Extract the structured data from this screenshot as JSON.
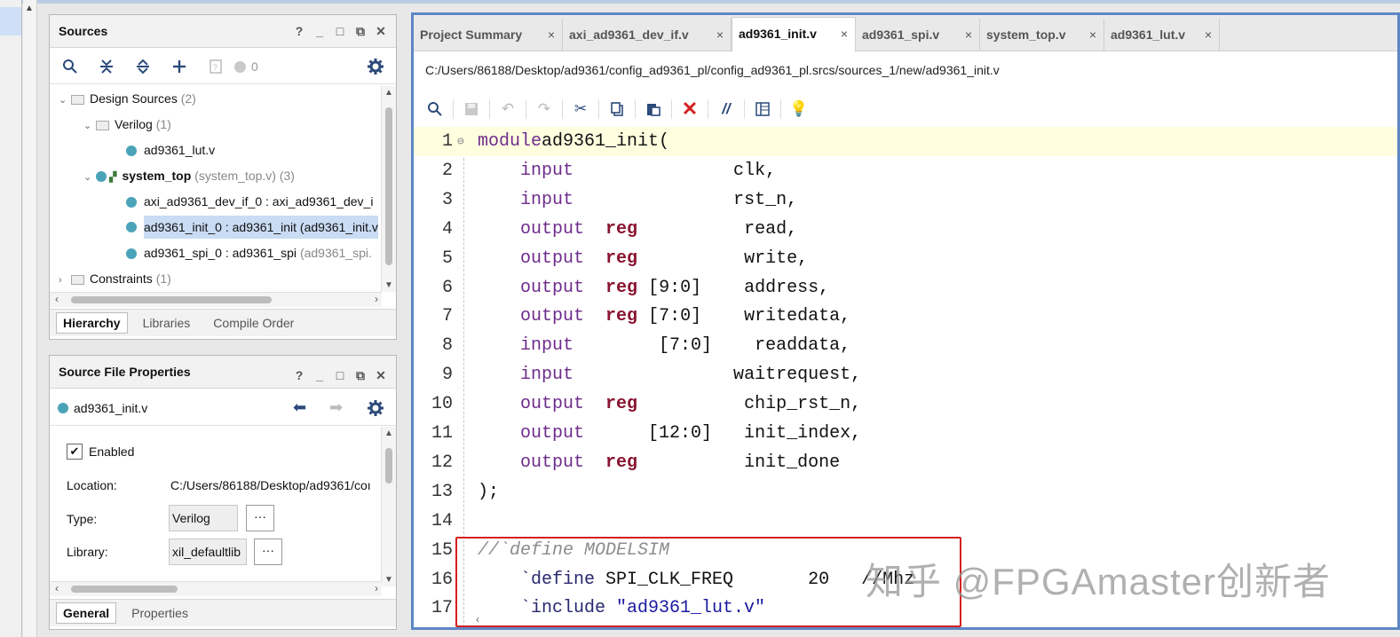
{
  "sources_panel": {
    "title": "Sources",
    "win_buttons": [
      "?",
      "_",
      "□",
      "⧉",
      "✕"
    ],
    "count": "0",
    "tree": [
      {
        "label": "Design Sources",
        "extra": "(2)"
      },
      {
        "label": "Verilog",
        "extra": "(1)"
      },
      {
        "label": "ad9361_lut.v",
        "extra": ""
      },
      {
        "label": "system_top",
        "extra": "(system_top.v) (3)"
      },
      {
        "label": "axi_ad9361_dev_if_0 : axi_ad9361_dev_i",
        "extra": ""
      },
      {
        "label": "ad9361_init_0 : ad9361_init (ad9361_init.v",
        "extra": ""
      },
      {
        "label": "ad9361_spi_0 : ad9361_spi",
        "extra": "(ad9361_spi."
      },
      {
        "label": "Constraints",
        "extra": "(1)"
      }
    ],
    "tabs": [
      "Hierarchy",
      "Libraries",
      "Compile Order"
    ]
  },
  "props_panel": {
    "title": "Source File Properties",
    "file": "ad9361_init.v",
    "enabled_label": "Enabled",
    "location_label": "Location:",
    "location_value": "C:/Users/86188/Desktop/ad9361/coı",
    "type_label": "Type:",
    "type_value": "Verilog",
    "library_label": "Library:",
    "library_value": "xil_defaultlib",
    "dots": "···",
    "tabs": [
      "General",
      "Properties"
    ]
  },
  "editor": {
    "tabs": [
      {
        "label": "Project Summary"
      },
      {
        "label": "axi_ad9361_dev_if.v"
      },
      {
        "label": "ad9361_init.v"
      },
      {
        "label": "ad9361_spi.v"
      },
      {
        "label": "system_top.v"
      },
      {
        "label": "ad9361_lut.v"
      }
    ],
    "close_glyph": "×",
    "path": "C:/Users/86188/Desktop/ad9361/config_ad9361_pl/config_ad9361_pl.srcs/sources_1/new/ad9361_init.v",
    "lines": [
      {
        "n": "1",
        "parts": [
          [
            "kw",
            "module"
          ],
          [
            "",
            "ad9361_init("
          ]
        ]
      },
      {
        "n": "2",
        "parts": [
          [
            "",
            "    "
          ],
          [
            "kw",
            "input"
          ],
          [
            "",
            "               clk,"
          ]
        ]
      },
      {
        "n": "3",
        "parts": [
          [
            "",
            "    "
          ],
          [
            "kw",
            "input"
          ],
          [
            "",
            "               rst_n,"
          ]
        ]
      },
      {
        "n": "4",
        "parts": [
          [
            "",
            "    "
          ],
          [
            "kw",
            "output"
          ],
          [
            "",
            "  "
          ],
          [
            "rg",
            "reg"
          ],
          [
            "",
            "          read,"
          ]
        ]
      },
      {
        "n": "5",
        "parts": [
          [
            "",
            "    "
          ],
          [
            "kw",
            "output"
          ],
          [
            "",
            "  "
          ],
          [
            "rg",
            "reg"
          ],
          [
            "",
            "          write,"
          ]
        ]
      },
      {
        "n": "6",
        "parts": [
          [
            "",
            "    "
          ],
          [
            "kw",
            "output"
          ],
          [
            "",
            "  "
          ],
          [
            "rg",
            "reg"
          ],
          [
            "",
            " [9:0]    address,"
          ]
        ]
      },
      {
        "n": "7",
        "parts": [
          [
            "",
            "    "
          ],
          [
            "kw",
            "output"
          ],
          [
            "",
            "  "
          ],
          [
            "rg",
            "reg"
          ],
          [
            "",
            " [7:0]    writedata,"
          ]
        ]
      },
      {
        "n": "8",
        "parts": [
          [
            "",
            "    "
          ],
          [
            "kw",
            "input"
          ],
          [
            "",
            "        [7:0]    readdata,"
          ]
        ]
      },
      {
        "n": "9",
        "parts": [
          [
            "",
            "    "
          ],
          [
            "kw",
            "input"
          ],
          [
            "",
            "               waitrequest,"
          ]
        ]
      },
      {
        "n": "10",
        "parts": [
          [
            "",
            "    "
          ],
          [
            "kw",
            "output"
          ],
          [
            "",
            "  "
          ],
          [
            "rg",
            "reg"
          ],
          [
            "",
            "          chip_rst_n,"
          ]
        ]
      },
      {
        "n": "11",
        "parts": [
          [
            "",
            "    "
          ],
          [
            "kw",
            "output"
          ],
          [
            "",
            "      [12:0]   init_index,"
          ]
        ]
      },
      {
        "n": "12",
        "parts": [
          [
            "",
            "    "
          ],
          [
            "kw",
            "output"
          ],
          [
            "",
            "  "
          ],
          [
            "rg",
            "reg"
          ],
          [
            "",
            "          init_done"
          ]
        ]
      },
      {
        "n": "13",
        "parts": [
          [
            "",
            ");"
          ]
        ]
      },
      {
        "n": "14",
        "parts": [
          [
            "",
            ""
          ]
        ]
      },
      {
        "n": "15",
        "parts": [
          [
            "cm",
            "//`define MODELSIM"
          ]
        ]
      },
      {
        "n": "16",
        "parts": [
          [
            "",
            "    "
          ],
          [
            "dir",
            "`define"
          ],
          [
            "",
            " SPI_CLK_FREQ       20   //Mhz"
          ]
        ]
      },
      {
        "n": "17",
        "parts": [
          [
            "",
            "    "
          ],
          [
            "dir",
            "`include"
          ],
          [
            "str",
            " \"ad9361_lut.v\""
          ]
        ]
      }
    ]
  },
  "watermark": "知乎 @FPGAmaster创新者",
  "colors": {
    "accent": "#5d87c6",
    "highlight_box": "#d42020",
    "keyword": "#6e2c8c",
    "reg": "#8a1530"
  }
}
